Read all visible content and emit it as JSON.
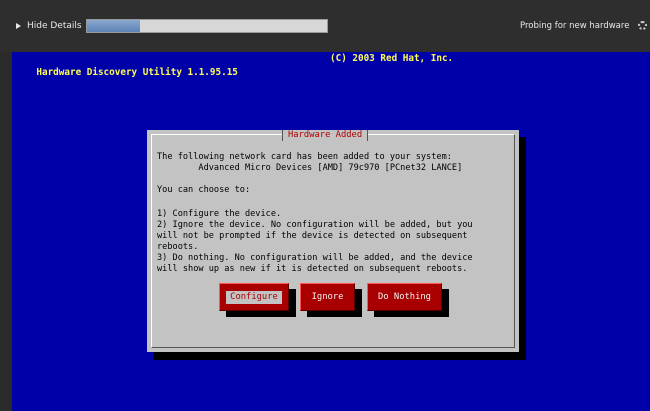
{
  "top_bar": {
    "hide_details_label": "Hide Details",
    "progress_fraction": 0.22,
    "status_text": "Probing for new hardware"
  },
  "header": {
    "app_title": "Hardware Discovery Utility 1.1.95.15",
    "copyright": "(C) 2003 Red Hat, Inc."
  },
  "dialog": {
    "title": "Hardware Added",
    "lines": [
      "The following network card has been added to your system:",
      "        Advanced Micro Devices [AMD] 79c970 [PCnet32 LANCE]",
      "You can choose to:",
      "1) Configure the device.",
      "2) Ignore the device. No configuration will be added, but you",
      "will not be prompted if the device is detected on subsequent",
      "reboots.",
      "3) Do nothing. No configuration will be added, and the device",
      "will show up as new if it is detected on subsequent reboots."
    ],
    "buttons": {
      "configure": "Configure",
      "ignore": "Ignore",
      "do_nothing": "Do Nothing"
    }
  },
  "colors": {
    "screen_bg": "#0000a8",
    "header_text": "#ffff55",
    "dialog_bg": "#c3c3c3",
    "dialog_title": "#b00000",
    "button_bg": "#a80000"
  }
}
